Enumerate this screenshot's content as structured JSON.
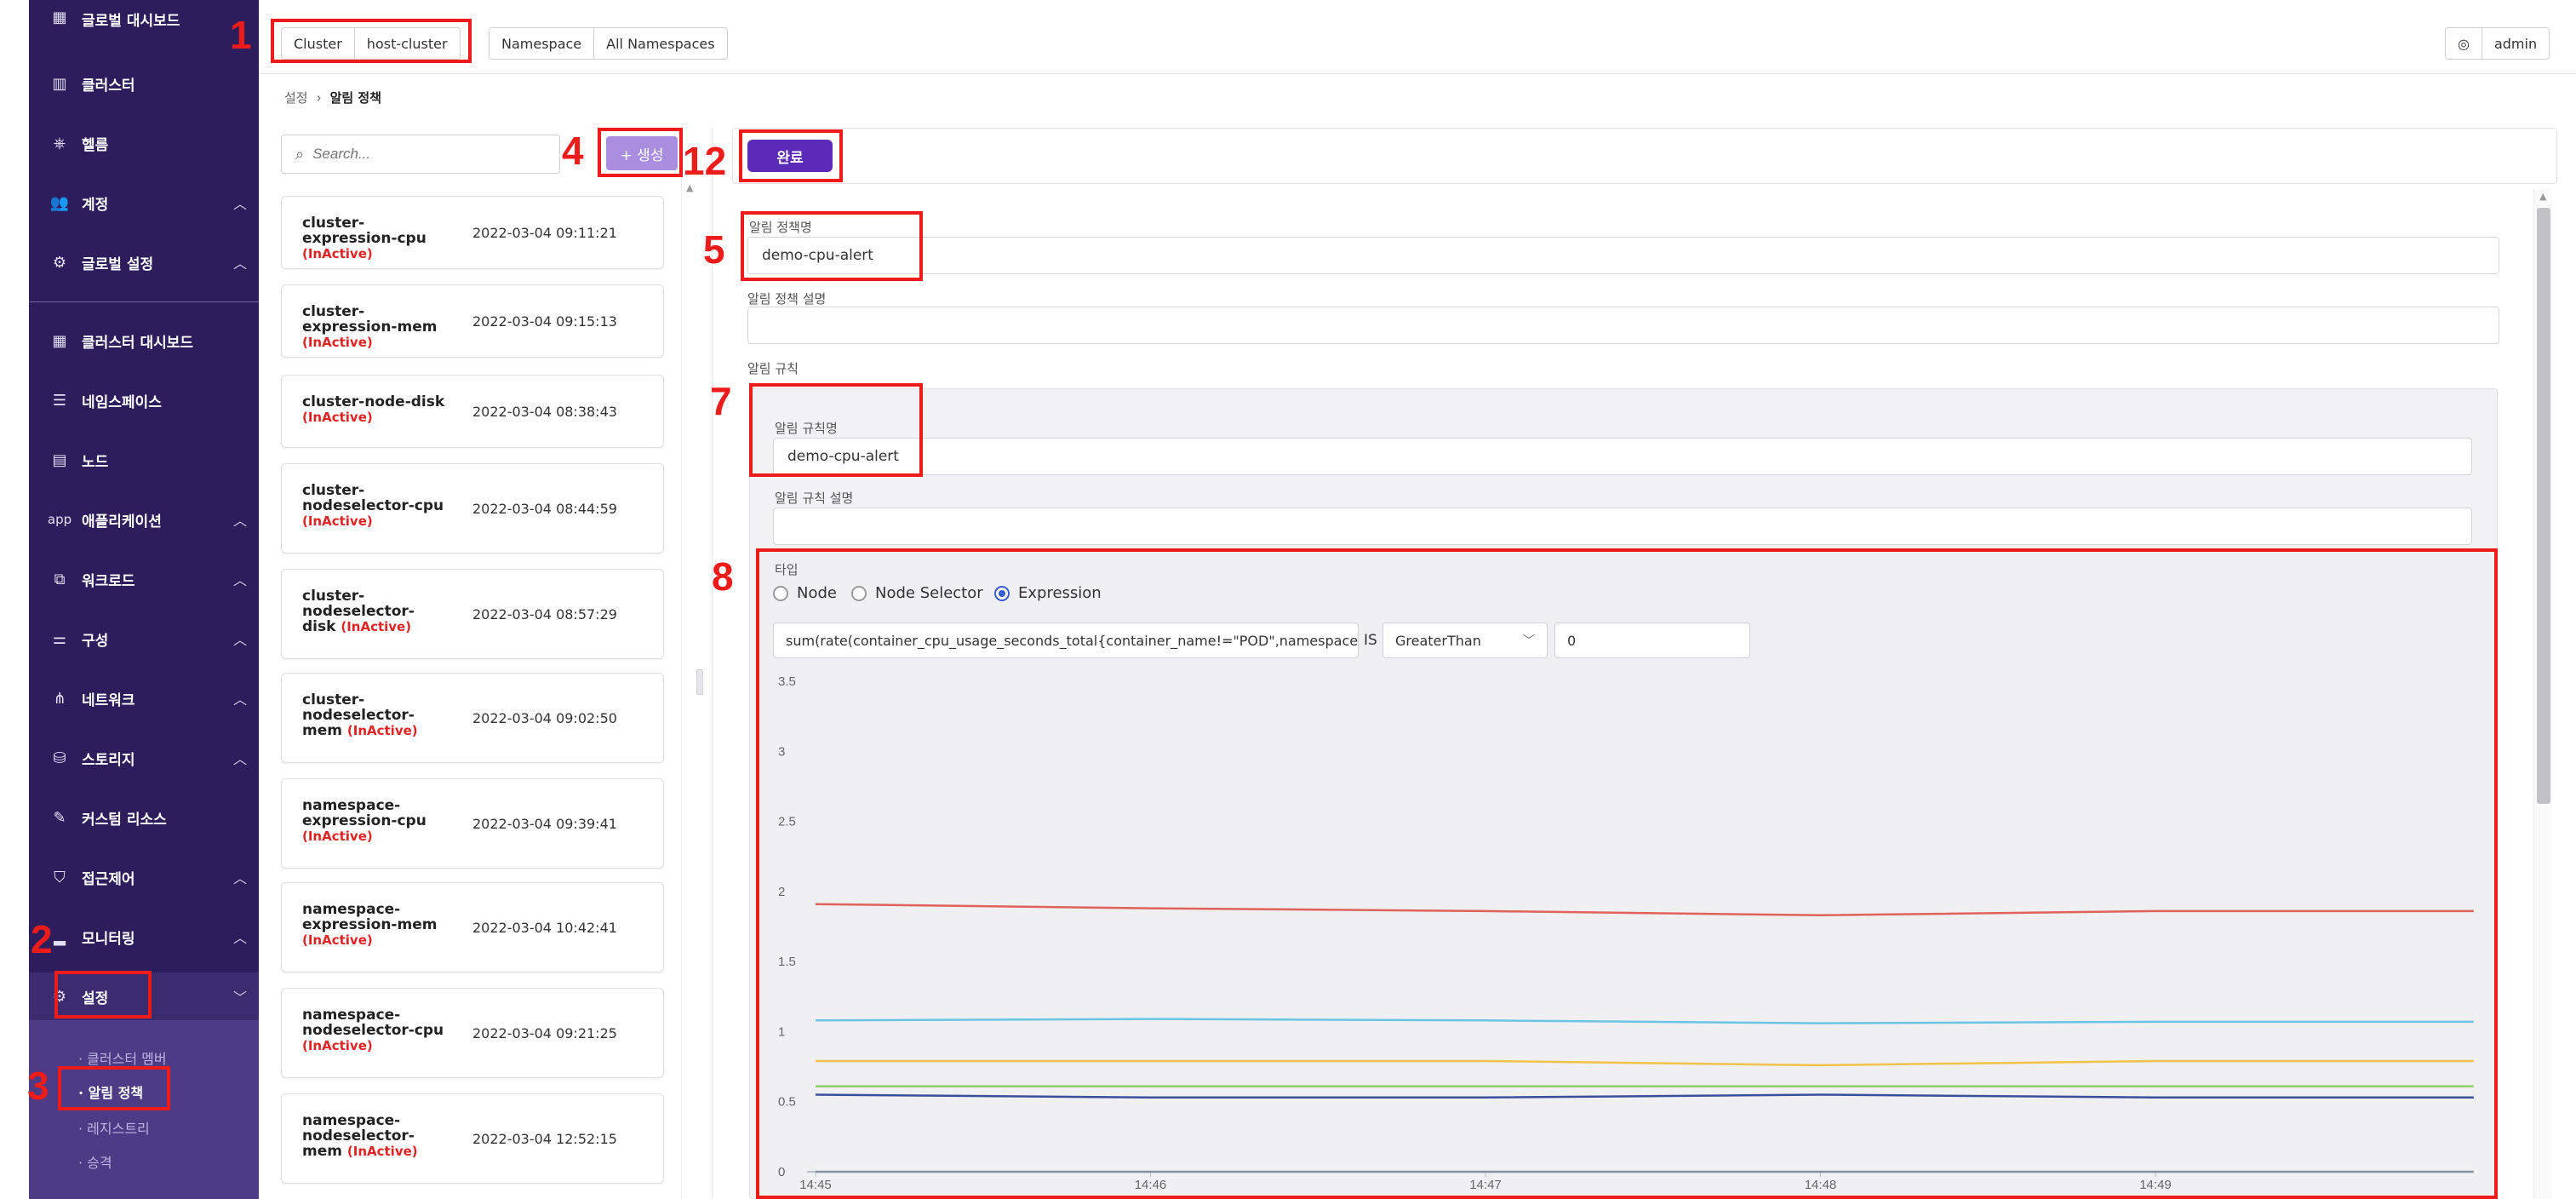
{
  "sidebar": {
    "items": [
      {
        "label": "글로벌 대시보드",
        "icon": "grid-icon",
        "chevron": ""
      },
      {
        "label": "클러스터",
        "icon": "columns-icon",
        "chevron": ""
      },
      {
        "label": "헬름",
        "icon": "helm-icon",
        "chevron": ""
      },
      {
        "label": "계정",
        "icon": "users-icon",
        "chevron": "^"
      },
      {
        "label": "글로벌 설정",
        "icon": "gear-icon",
        "chevron": "^"
      },
      {
        "label": "클러스터 대시보드",
        "icon": "grid-icon",
        "chevron": ""
      },
      {
        "label": "네임스페이스",
        "icon": "layers-icon",
        "chevron": ""
      },
      {
        "label": "노드",
        "icon": "server-icon",
        "chevron": ""
      },
      {
        "label": "애플리케이션",
        "icon": "app-icon",
        "chevron": "^"
      },
      {
        "label": "워크로드",
        "icon": "workload-icon",
        "chevron": "^"
      },
      {
        "label": "구성",
        "icon": "sliders-icon",
        "chevron": "^"
      },
      {
        "label": "네트워크",
        "icon": "network-icon",
        "chevron": "^"
      },
      {
        "label": "스토리지",
        "icon": "storage-icon",
        "chevron": "^"
      },
      {
        "label": "커스텀 리소스",
        "icon": "custom-resource-icon",
        "chevron": ""
      },
      {
        "label": "접근제어",
        "icon": "shield-icon",
        "chevron": "^"
      },
      {
        "label": "모니터링",
        "icon": "chart-icon",
        "chevron": "^"
      },
      {
        "label": "설정",
        "icon": "gear-icon",
        "chevron": "v"
      }
    ],
    "app_icon_text": "app",
    "submenu": [
      "· 클러스터 멤버",
      "· 알림 정책",
      "· 레지스트리",
      "· 승격"
    ]
  },
  "topbar": {
    "cluster_label": "Cluster",
    "cluster_value": "host-cluster",
    "namespace_label": "Namespace",
    "namespace_value": "All Namespaces",
    "user": "admin"
  },
  "breadcrumb": {
    "parent": "설정",
    "separator": "›",
    "current": "알림 정책"
  },
  "list": {
    "search_placeholder": "Search...",
    "create_label": "+ 생성",
    "items": [
      {
        "name": "cluster-expression-cpu",
        "status": "(InActive)",
        "date": "2022-03-04 09:11:21"
      },
      {
        "name": "cluster-expression-mem",
        "status": "(InActive)",
        "date": "2022-03-04 09:15:13"
      },
      {
        "name": "cluster-node-disk",
        "status": "(InActive)",
        "date": "2022-03-04 08:38:43"
      },
      {
        "name": "cluster-nodeselector-cpu",
        "status": "(InActive)",
        "date": "2022-03-04 08:44:59"
      },
      {
        "name": "cluster-nodeselector-disk",
        "status": "(InActive)",
        "date": "2022-03-04 08:57:29"
      },
      {
        "name": "cluster-nodeselector-mem",
        "status": "(InActive)",
        "date": "2022-03-04 09:02:50"
      },
      {
        "name": "namespace-expression-cpu",
        "status": "(InActive)",
        "date": "2022-03-04 09:39:41"
      },
      {
        "name": "namespace-expression-mem",
        "status": "(InActive)",
        "date": "2022-03-04 10:42:41"
      },
      {
        "name": "namespace-nodeselector-cpu",
        "status": "(InActive)",
        "date": "2022-03-04 09:21:25"
      },
      {
        "name": "namespace-nodeselector-mem",
        "status": "(InActive)",
        "date": "2022-03-04 12:52:15"
      }
    ]
  },
  "detail": {
    "done_label": "완료",
    "policy_name_label": "알림 정책명",
    "policy_name_value": "demo-cpu-alert",
    "policy_desc_label": "알림 정책 설명",
    "policy_desc_value": "",
    "rules_label": "알림 규칙",
    "rule_name_label": "알림 규칙명",
    "rule_name_value": "demo-cpu-alert",
    "rule_desc_label": "알림 규칙 설명",
    "rule_desc_value": "",
    "type_label": "타입",
    "type_options": [
      "Node",
      "Node Selector",
      "Expression"
    ],
    "selected_type": "Expression",
    "expression": "sum(rate(container_cpu_usage_seconds_total{container_name!=\"POD\",namespace!=\"",
    "is_label": "IS",
    "operator": "GreaterThan",
    "threshold": "0"
  },
  "annotations": [
    "1",
    "2",
    "3",
    "4",
    "5",
    "7",
    "8",
    "12"
  ],
  "chart_data": {
    "type": "line",
    "x": [
      "14:45",
      "14:46",
      "14:47",
      "14:48",
      "14:49"
    ],
    "x_ticks": [
      "14:45",
      "14:46",
      "14:47",
      "14:48",
      "14:49"
    ],
    "y_ticks": [
      "0",
      "0.5",
      "1",
      "1.5",
      "2",
      "2.5",
      "3",
      "3.5"
    ],
    "ylim": [
      0,
      3.5
    ],
    "grid": false,
    "series": [
      {
        "color": "#e0625a",
        "points": [
          [
            0,
            1.91
          ],
          [
            1,
            1.88
          ],
          [
            2,
            1.86
          ],
          [
            3,
            1.83
          ],
          [
            4,
            1.86
          ],
          [
            4.95,
            1.86
          ]
        ]
      },
      {
        "color": "#6cc4e4",
        "points": [
          [
            0,
            1.08
          ],
          [
            1,
            1.09
          ],
          [
            2,
            1.08
          ],
          [
            3,
            1.06
          ],
          [
            4,
            1.07
          ],
          [
            4.95,
            1.07
          ]
        ]
      },
      {
        "color": "#f2c24a",
        "points": [
          [
            0,
            0.79
          ],
          [
            1,
            0.79
          ],
          [
            2,
            0.79
          ],
          [
            3,
            0.76
          ],
          [
            4,
            0.79
          ],
          [
            4.95,
            0.79
          ]
        ]
      },
      {
        "color": "#8dcf6a",
        "points": [
          [
            0,
            0.61
          ],
          [
            1,
            0.61
          ],
          [
            2,
            0.61
          ],
          [
            3,
            0.61
          ],
          [
            4,
            0.61
          ],
          [
            4.95,
            0.61
          ]
        ]
      },
      {
        "color": "#3a4f9c",
        "points": [
          [
            0,
            0.55
          ],
          [
            1,
            0.53
          ],
          [
            2,
            0.53
          ],
          [
            3,
            0.55
          ],
          [
            4,
            0.53
          ],
          [
            4.95,
            0.53
          ]
        ]
      },
      {
        "color": "#8a8fa0",
        "points": [
          [
            0,
            0.0
          ],
          [
            1,
            0.0
          ],
          [
            2,
            0.0
          ],
          [
            3,
            0.0
          ],
          [
            4,
            0.0
          ],
          [
            4.95,
            0.0
          ]
        ]
      }
    ]
  },
  "colors": {
    "sidebar": "#2d1d5c",
    "accent": "#5b2ab8",
    "create_button": "#a98ee0",
    "inactive": "#e02424",
    "annotation": "#ee1b1b"
  }
}
